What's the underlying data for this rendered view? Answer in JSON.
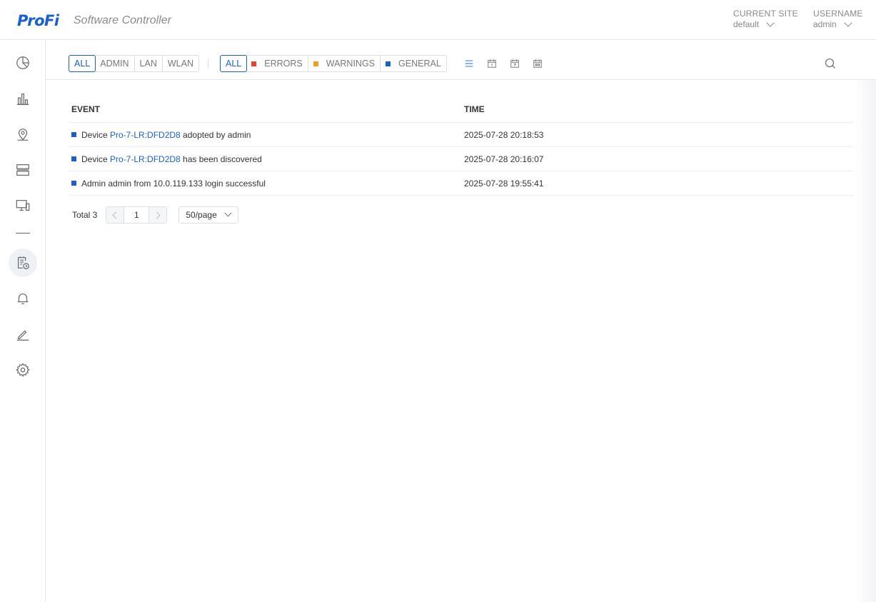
{
  "brand": {
    "logo": "ProFi",
    "subtitle": "Software Controller"
  },
  "header": {
    "site": {
      "label": "CURRENT SITE",
      "value": "default"
    },
    "user": {
      "label": "USERNAME",
      "value": "admin"
    }
  },
  "sidebar": {
    "items": [
      {
        "name": "dashboard",
        "icon": "pie-chart-icon"
      },
      {
        "name": "statistics",
        "icon": "bar-chart-icon"
      },
      {
        "name": "map",
        "icon": "map-pin-icon"
      },
      {
        "name": "devices",
        "icon": "server-icon"
      },
      {
        "name": "clients",
        "icon": "monitor-icon"
      },
      {
        "name": "events",
        "icon": "event-log-icon",
        "active": true
      },
      {
        "name": "alerts",
        "icon": "bell-icon"
      },
      {
        "name": "edit",
        "icon": "pen-icon"
      },
      {
        "name": "settings",
        "icon": "gear-icon"
      }
    ]
  },
  "filters": {
    "source": [
      {
        "label": "ALL",
        "active": true
      },
      {
        "label": "ADMIN"
      },
      {
        "label": "LAN"
      },
      {
        "label": "WLAN"
      }
    ],
    "severity": [
      {
        "label": "ALL",
        "active": true
      },
      {
        "label": "ERRORS",
        "color": "#e8432f"
      },
      {
        "label": "WARNINGS",
        "color": "#f0a020"
      },
      {
        "label": "GENERAL",
        "color": "#1a5fd0"
      }
    ],
    "views": [
      "list-icon",
      "calendar-day-icon",
      "calendar-week-icon",
      "calendar-month-icon"
    ]
  },
  "table": {
    "headers": {
      "event": "EVENT",
      "time": "TIME"
    },
    "rows": [
      {
        "prefix": "Device ",
        "link": "Pro-7-LR:DFD2D8",
        "suffix": " adopted by admin",
        "time": "2025-07-28 20:18:53"
      },
      {
        "prefix": "Device ",
        "link": "Pro-7-LR:DFD2D8",
        "suffix": " has been discovered",
        "time": "2025-07-28 20:16:07"
      },
      {
        "prefix": "Admin admin from 10.0.119.133 login successful",
        "link": "",
        "suffix": "",
        "time": "2025-07-28 19:55:41"
      }
    ]
  },
  "pagination": {
    "total": "Total 3",
    "page": "1",
    "page_size": "50/page"
  },
  "colors": {
    "accent": "#1a5fd0",
    "error": "#e8432f",
    "warning": "#f0a020",
    "general": "#1a5fd0"
  }
}
